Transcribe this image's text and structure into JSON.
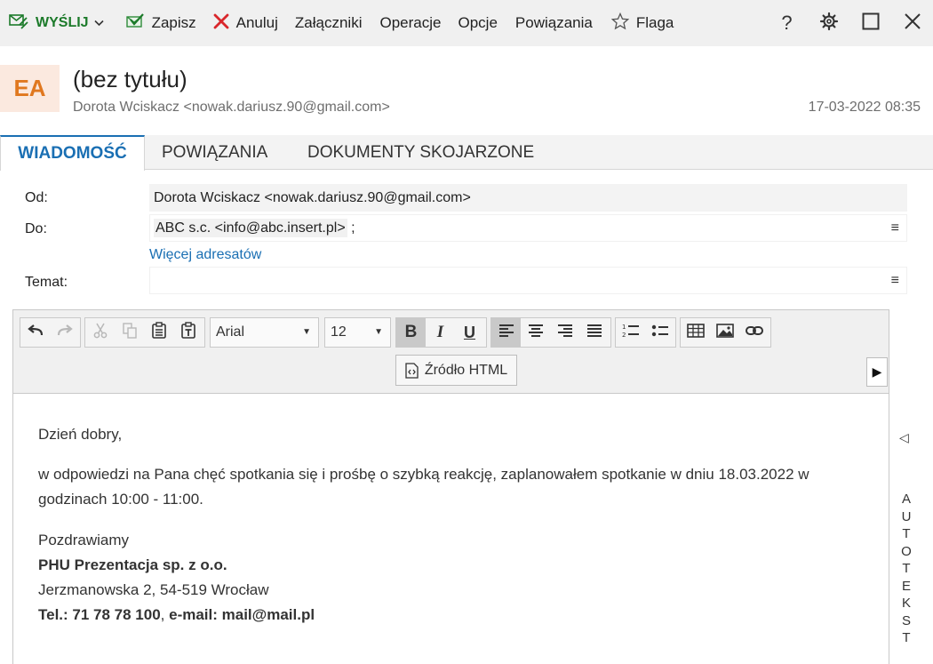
{
  "toolbar": {
    "send_label": "WYŚLIJ",
    "save_label": "Zapisz",
    "cancel_label": "Anuluj",
    "attachments_label": "Załączniki",
    "operations_label": "Operacje",
    "options_label": "Opcje",
    "links_label": "Powiązania",
    "flag_label": "Flaga",
    "help_label": "?"
  },
  "header": {
    "avatar_initials": "EA",
    "subject": "(bez tytułu)",
    "sender": "Dorota Wciskacz <nowak.dariusz.90@gmail.com>",
    "date": "17-03-2022 08:35"
  },
  "tabs": [
    {
      "label": "WIADOMOŚĆ",
      "active": true
    },
    {
      "label": "POWIĄZANIA",
      "active": false
    },
    {
      "label": "DOKUMENTY SKOJARZONE",
      "active": false
    }
  ],
  "form": {
    "from_label": "Od:",
    "from_value": "Dorota Wciskacz <nowak.dariusz.90@gmail.com>",
    "to_label": "Do:",
    "to_value": "ABC s.c. <info@abc.insert.pl>",
    "to_separator": ";",
    "more_recipients_label": "Więcej adresatów",
    "subject_label": "Temat:",
    "subject_value": "",
    "menu_glyph": "≡"
  },
  "editor": {
    "font_name": "Arial",
    "font_size": "12",
    "source_label": "Źródło HTML",
    "expand_glyph": "▶",
    "body": {
      "greeting": "Dzień dobry,",
      "paragraph": "w odpowiedzi na Pana chęć spotkania się i  prośbę o szybką reakcję, zaplanowałem spotkanie w dniu 18.03.2022 w godzinach 10:00 - 11:00.",
      "closing": "Pozdrawiamy",
      "company": "PHU Prezentacja sp. z o.o.",
      "address": "Jerzmanowska 2, 54-519 Wrocław",
      "contact_tel": "Tel.: 71 78 78 100",
      "contact_sep": ", ",
      "contact_email": "e-mail: mail@mail.pl"
    }
  },
  "autotext": {
    "collapse_glyph": "◁",
    "label": "AUTOTEKST"
  },
  "colors": {
    "accent": "#1a6fb3",
    "send_green": "#1c7a2a",
    "cancel_red": "#d9262b",
    "avatar_bg": "#fbe9df",
    "avatar_fg": "#e0781f"
  }
}
